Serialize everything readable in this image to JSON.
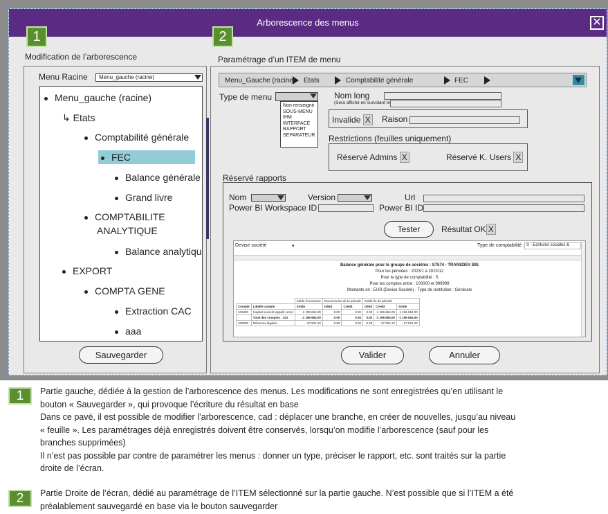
{
  "window": {
    "title": "Arborescence des menus",
    "close_glyph": "✕"
  },
  "badges": {
    "one": "1",
    "two": "2"
  },
  "left": {
    "section_title": "Modification de l’arborescence",
    "menu_racine_label": "Menu Racine",
    "menu_racine_value": "Menu_gauche (racine)",
    "tree": [
      {
        "label": "Menu_gauche (racine)",
        "bullet": true
      },
      {
        "label": "↳ Etats",
        "bullet": false
      },
      {
        "label": "Comptabilité générale",
        "bullet": true
      },
      {
        "label": "FEC",
        "bullet": true,
        "selected": true
      },
      {
        "label": "Balance générale",
        "bullet": true
      },
      {
        "label": "Grand livre",
        "bullet": true
      },
      {
        "label": "COMPTABILITE",
        "bullet": true
      },
      {
        "label": "ANALYTIQUE",
        "bullet": false
      },
      {
        "label": "Balance analytique",
        "bullet": true
      },
      {
        "label": "EXPORT",
        "bullet": true
      },
      {
        "label": "COMPTA GENE",
        "bullet": true
      },
      {
        "label": "Extraction CAC",
        "bullet": true
      },
      {
        "label": "aaa",
        "bullet": true
      }
    ],
    "save_button": "Sauvegarder"
  },
  "right": {
    "section_title": "Paramétrage d’un ITEM de menu",
    "breadcrumb": [
      "Menu_Gauche (racine)",
      "Etats",
      "Comptabilité générale",
      "FEC"
    ],
    "type_menu_label": "Type de menu",
    "type_menu_options": [
      "Non renseigné",
      "SOUS-MENU",
      "IHM",
      "INTERFACE",
      "RAPPORT",
      "SEPARATEUR"
    ],
    "nom_long_label": "Nom long",
    "nom_long_hint": "(Sera affiché en survolant le menu avec la souris)",
    "invalide_label": "Invalide",
    "raison_label": "Raison",
    "check_mark": "X",
    "restrictions_label": "Restrictions (feuilles uniquement)",
    "reserve_admins": "Réservé Admins",
    "reserve_kusers": "Réservé K. Users",
    "reserve_rapports_label": "Réservé rapports",
    "nom_label": "Nom",
    "version_label": "Version",
    "url_label": "Url",
    "workspace_label": "Power BI Workspace ID",
    "powerbi_id_label": "Power BI ID",
    "tester_button": "Tester",
    "resultat_label": "Résultat OK",
    "preview": {
      "devise": "Devise société",
      "type_compta_label": "Type de comptabilité :",
      "type_compta_value": "S - Ecritures sociales &",
      "title": "Balance générale pour le groupe de sociétés : S7574 - TRANSDEV BIS",
      "l1": "Pour les périodes : 2023/1 à 2023/12",
      "l2": "Pour le type de comptabilité : S",
      "l3": "Pour les comptes entre : 100000 et 999999",
      "l4": "Montants en : EUR  (Devise Société) - Type de restitution : Générale",
      "groups": [
        "Solde d'ouverture",
        "Mouvements de la période",
        "Solde fin de période"
      ],
      "cols": [
        "Compte",
        "Libellé compte",
        "Solde",
        "Débit",
        "Crédit",
        "Débit",
        "Crédit",
        "Solde"
      ],
      "rows": [
        [
          "101300",
          "Capital souscrit-appelé versé",
          "-1 196 654.00",
          "0.00",
          "0.00",
          "0.00",
          "-1 196 654.00",
          "-1 196 654.00"
        ],
        [
          "",
          "Total des comptes : 101",
          "-1 196 654.00",
          "0.00",
          "0.00",
          "0.00",
          "-1 196 654.00",
          "-1 196 654.00"
        ],
        [
          "106000",
          "Réserves légales",
          "-37 921.22",
          "0.00",
          "0.00",
          "0.00",
          "-37 921.22",
          "-37 921.22"
        ]
      ]
    },
    "valider_button": "Valider",
    "annuler_button": "Annuler"
  },
  "notes": {
    "n1_l1": "Partie gauche, dédiée à la gestion de l’arborescence des menus. Les modifications ne sont enregistrées qu’en utilisant le",
    "n1_l2": "bouton « Sauvegarder », qui provoque l’écriture du résultat en base",
    "n1_l3": "Dans ce pavé, il est possible de modifier l’arborescence, cad  : déplacer une branche, en créer de nouvelles, jusqu’au niveau",
    "n1_l4": "« feuille ». Les paramétrages déjà enregistrés doivent être conservés, lorsqu’on modifie l’arborescence (sauf pour les",
    "n1_l5": "branches supprimées)",
    "n1_l6": "Il n’est pas possible par contre de paramétrer les menus : donner un type, préciser le rapport, etc. sont traités sur la partie",
    "n1_l7": "droite de l’écran.",
    "n2_l1": "Partie Droite de l’écran, dédié au paramétrage de l’ITEM sélectionné sur la partie gauche. N’est possible que si l’ITEM a été",
    "n2_l2": "préalablement sauvegardé en base via le bouton sauvegarder"
  }
}
